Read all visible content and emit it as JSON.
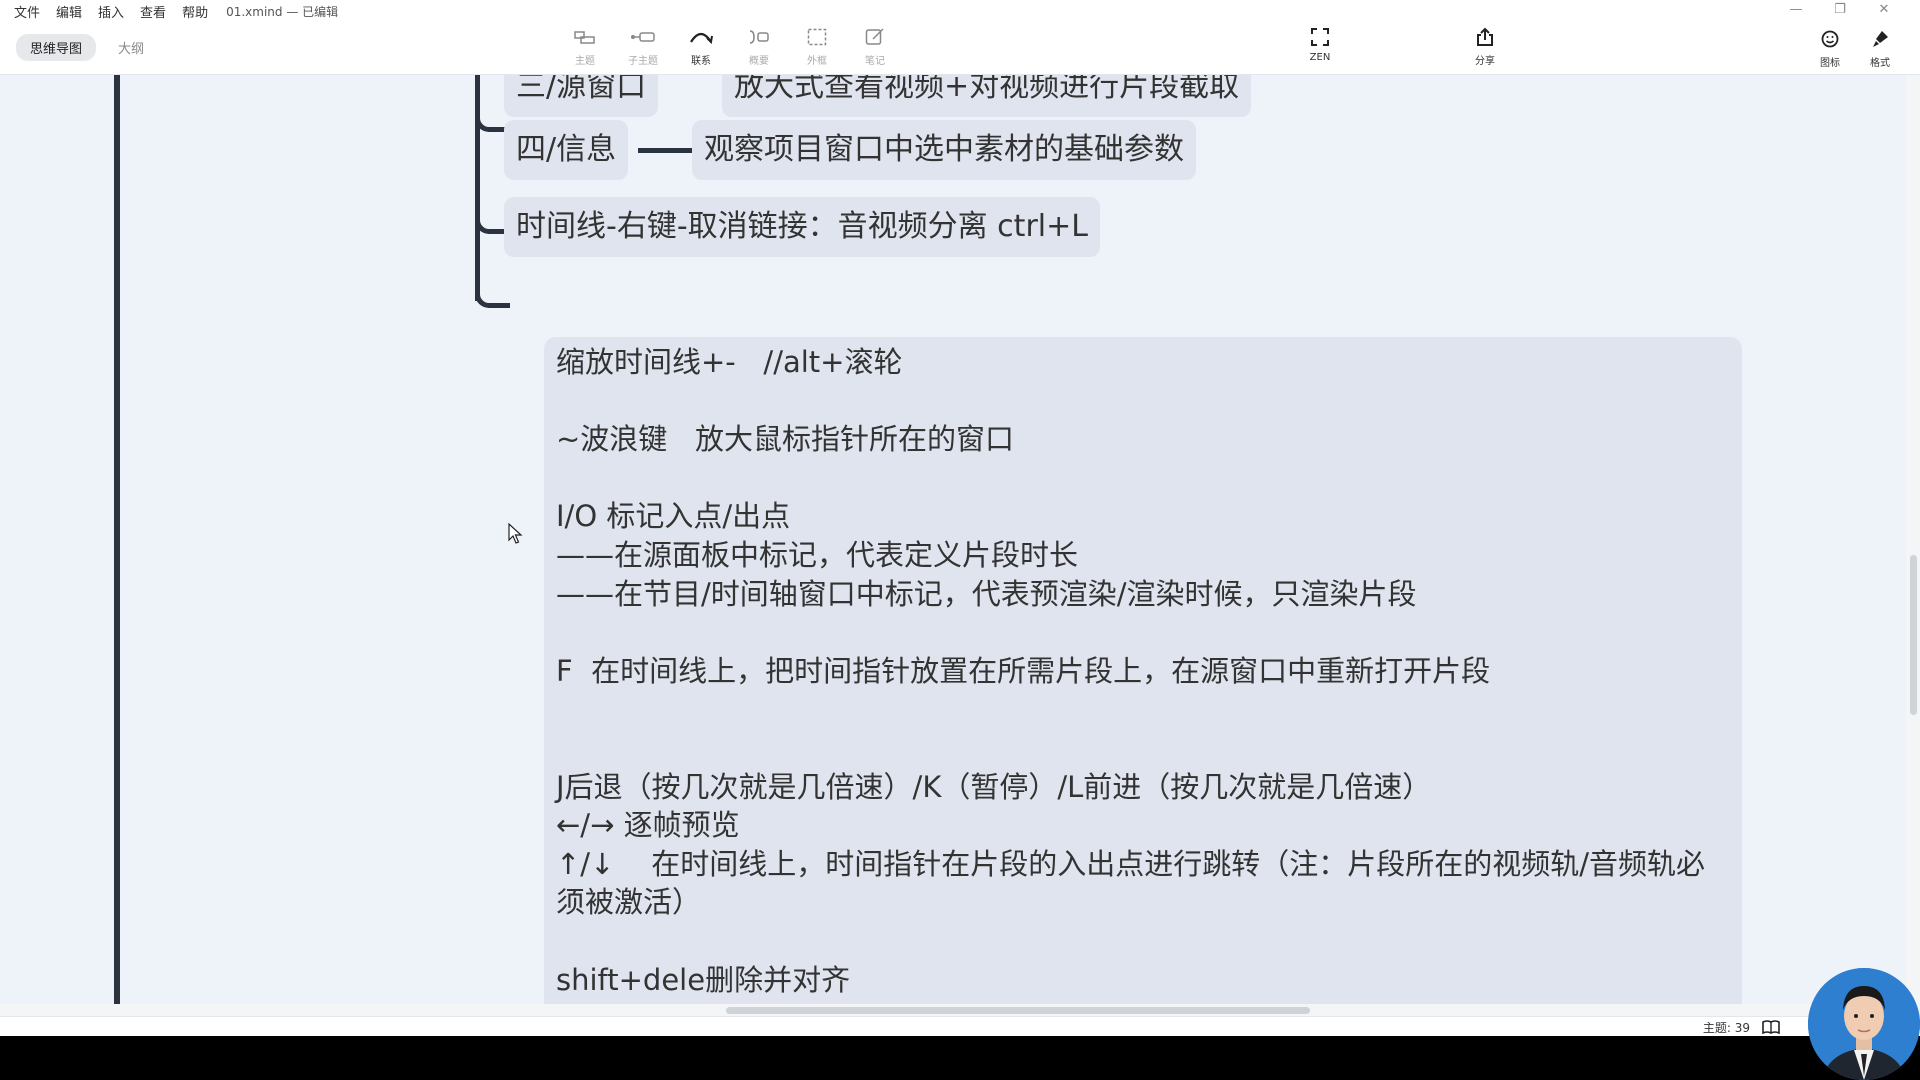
{
  "menubar": {
    "items": [
      "文件",
      "编辑",
      "插入",
      "查看",
      "帮助"
    ],
    "file_title": "01.xmind — 已编辑"
  },
  "view_tabs": [
    "思维导图",
    "大纲"
  ],
  "toolbar": {
    "topic": "主题",
    "subtopic": "子主题",
    "relation": "联系",
    "summary": "概要",
    "boundary": "外框",
    "note": "笔记",
    "zen": "ZEN",
    "share": "分享",
    "icon": "图标",
    "format": "格式"
  },
  "topics": {
    "t1": "三/源窗口",
    "t1_note": "放大式查看视频+对视频进行片段截取",
    "t2": "四/信息",
    "t2_note": "观察项目窗口中选中素材的基础参数",
    "t3": "时间线-右键-取消链接：音视频分离 ctrl+L"
  },
  "note_lines": [
    "缩放时间线+-   //alt+滚轮",
    "",
    "~波浪键   放大鼠标指针所在的窗口",
    "",
    "I/O 标记入点/出点",
    "——在源面板中标记，代表定义片段时长",
    "——在节目/时间轴窗口中标记，代表预渲染/渲染时候，只渲染片段",
    "",
    "F  在时间线上，把时间指针放置在所需片段上，在源窗口中重新打开片段",
    "",
    "",
    "J后退（按几次就是几倍速）/K（暂停）/L前进（按几次就是几倍速）",
    "←/→ 逐帧预览",
    "↑/↓    在时间线上，时间指针在片段的入出点进行跳转（注：片段所在的视频轨/音频轨必须被激活）",
    "",
    "shift+dele删除并对齐"
  ],
  "status": {
    "topic_count": "主题: 39"
  },
  "colors": {
    "branch": "#2b3340",
    "topic_bg": "#dfe4ee",
    "canvas_bg": "#eef3fa"
  }
}
